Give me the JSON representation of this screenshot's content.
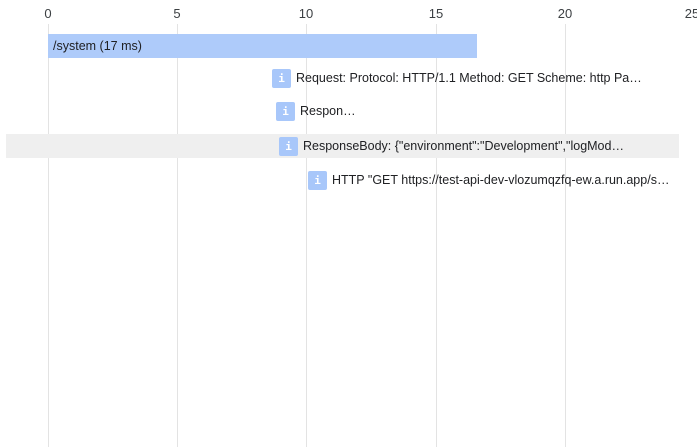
{
  "axis": {
    "ticks": [
      "0",
      "5",
      "10",
      "15",
      "20",
      "25"
    ]
  },
  "span": {
    "label": "/system (17 ms)"
  },
  "logs": [
    {
      "icon": "i",
      "text": "Request: Protocol: HTTP/1.1 Method: GET Scheme: http Pa…"
    },
    {
      "icon": "i",
      "text": "Respon…"
    },
    {
      "icon": "i",
      "text": "ResponseBody: {\"environment\":\"Development\",\"logMod…"
    },
    {
      "icon": "i",
      "text": "HTTP \"GET https://test-api-dev-vlozumqzfq-ew.a.run.app/s…"
    }
  ],
  "colors": {
    "span_bar": "#aecbfa",
    "log_icon": "#a8c7fa",
    "row_highlight": "#efefef",
    "gridline": "#e3e3e3"
  }
}
